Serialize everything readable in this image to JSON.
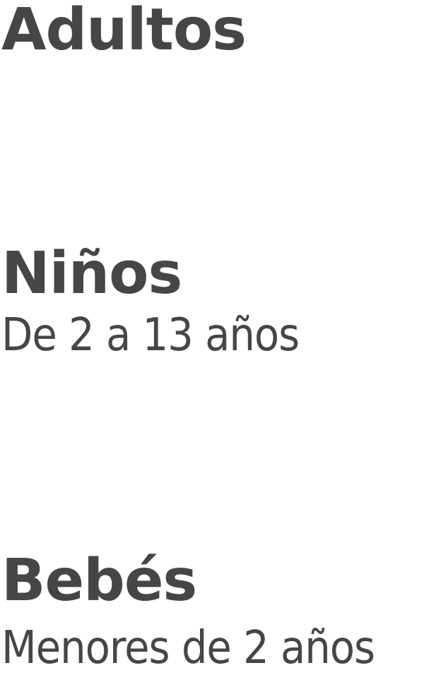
{
  "passengers": {
    "adults": {
      "label": "Adultos"
    },
    "children": {
      "label": "Niños",
      "description": "De 2 a 13 años"
    },
    "infants": {
      "label": "Bebés",
      "description": "Menores de 2 años"
    }
  }
}
